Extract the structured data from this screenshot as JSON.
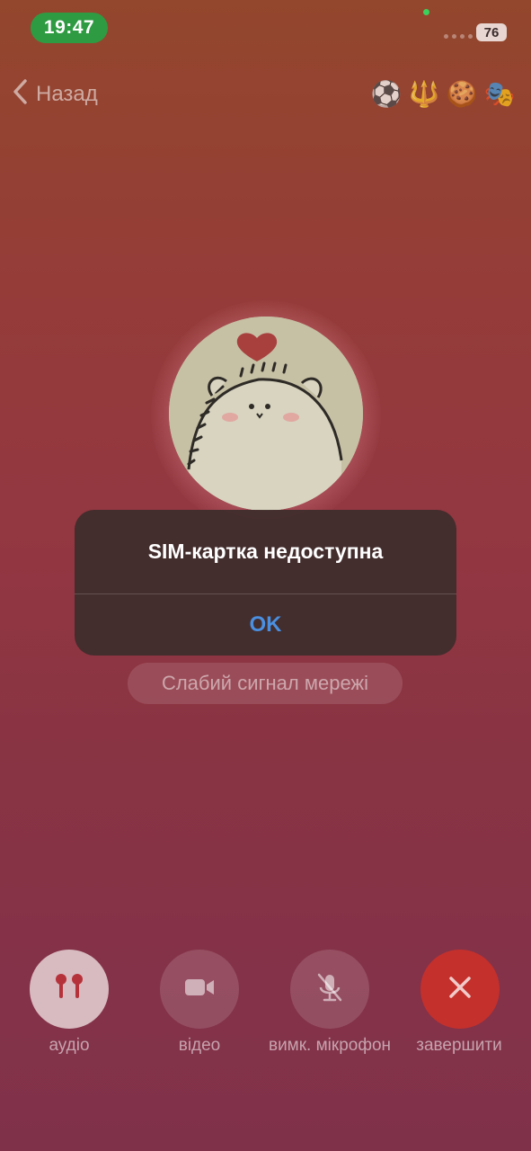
{
  "status_bar": {
    "time": "19:47",
    "battery": "76"
  },
  "nav": {
    "back_label": "Назад",
    "emoji": [
      "⚽",
      "🔱",
      "🍪",
      "🎭"
    ]
  },
  "call": {
    "network_status": "Слабий сигнал мережі"
  },
  "alert": {
    "title": "SIM-картка недоступна",
    "ok_label": "OK"
  },
  "controls": {
    "audio_label": "аудіо",
    "video_label": "відео",
    "mute_label": "вимк. мікрофон",
    "end_label": "завершити"
  },
  "colors": {
    "time_pill": "#2e9b42",
    "alert_button": "#4a8fe0",
    "end_call": "#c4302c"
  }
}
